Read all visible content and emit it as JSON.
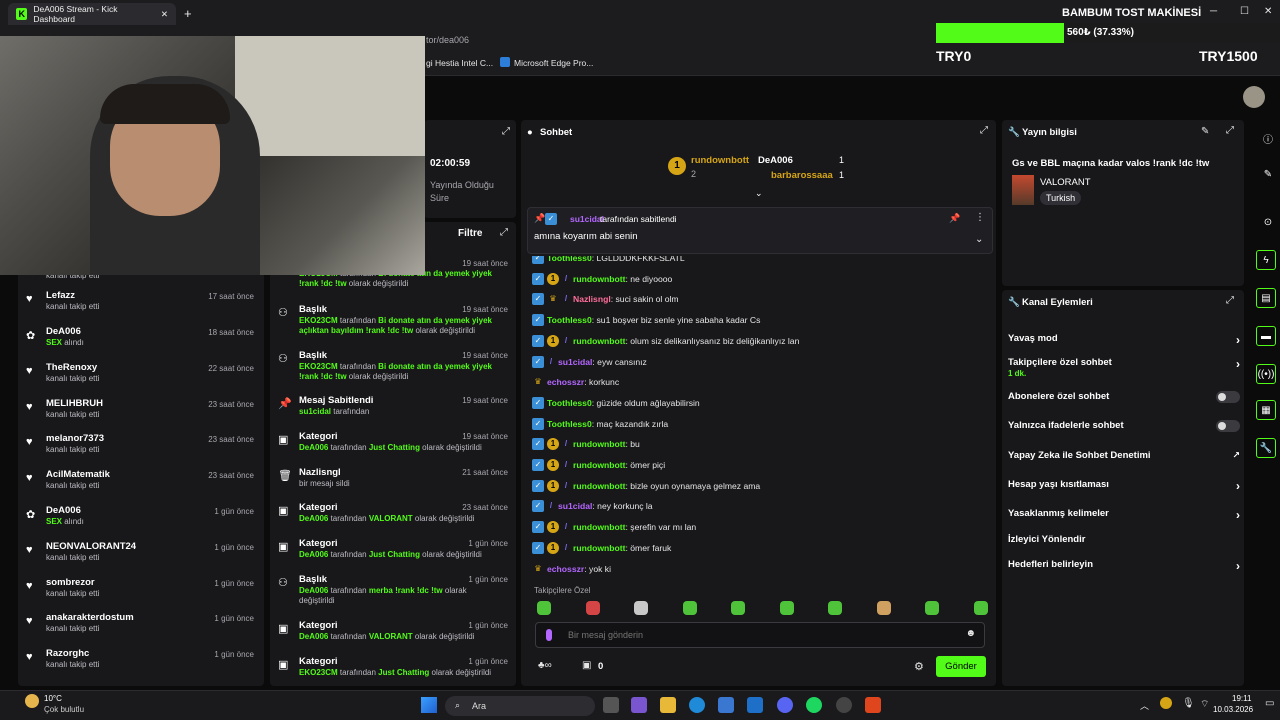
{
  "browser": {
    "tab_title": "DeA006 Stream - Kick Dashboard",
    "address_suffix": "tor/dea006",
    "bookmarks": [
      "gi Hestia Intel C...",
      "Microsoft Edge Pro..."
    ]
  },
  "overlay": {
    "goal_title": "BAMBUM TOST MAKİNESİ",
    "progress_text": "560₺ (37.33%)",
    "progress_fraction": 0.3733,
    "start_label": "TRY0",
    "end_label": "TRY1500"
  },
  "stream_info_panel": {
    "uptime": "02:00:59",
    "uptime_label_1": "Yayında Olduğu",
    "uptime_label_2": "Süre"
  },
  "follows": [
    {
      "name": "",
      "sub": "kanalı takip etti",
      "time": ""
    },
    {
      "name": "Lefazz",
      "sub": "kanalı takip etti",
      "time": "17 saat önce",
      "icon": "heart-icon"
    },
    {
      "name": "DeA006",
      "sub": "SEX",
      "sub2": " alındı",
      "time": "18 saat önce",
      "icon": "gift-icon"
    },
    {
      "name": "TheRenoxy",
      "sub": "kanalı takip etti",
      "time": "22 saat önce",
      "icon": "heart-icon"
    },
    {
      "name": "MELIHBRUH",
      "sub": "kanalı takip etti",
      "time": "23 saat önce",
      "icon": "heart-icon"
    },
    {
      "name": "melanor7373",
      "sub": "kanalı takip etti",
      "time": "23 saat önce",
      "icon": "heart-icon"
    },
    {
      "name": "AcilMatematik",
      "sub": "kanalı takip etti",
      "time": "23 saat önce",
      "icon": "heart-icon"
    },
    {
      "name": "DeA006",
      "sub": "SEX",
      "sub2": " alındı",
      "time": "1 gün önce",
      "icon": "gift-icon"
    },
    {
      "name": "NEONVALORANT24",
      "sub": "kanalı takip etti",
      "time": "1 gün önce",
      "icon": "heart-icon"
    },
    {
      "name": "sombrezor",
      "sub": "kanalı takip etti",
      "time": "1 gün önce",
      "icon": "heart-icon"
    },
    {
      "name": "anakarakterdostum",
      "sub": "kanalı takip etti",
      "time": "1 gün önce",
      "icon": "heart-icon"
    },
    {
      "name": "Razorghc",
      "sub": "kanalı takip etti",
      "time": "1 gün önce",
      "icon": "heart-icon"
    }
  ],
  "activity": {
    "filter_label": "Filtre",
    "items": [
      {
        "name": "",
        "time": "19 saat önce",
        "user": "EKO23CM",
        "t1": " tarafından ",
        "val": "Bi donate atın da yemek yiyek !rank !dc !tw",
        "t2": " olarak değiştirildi"
      },
      {
        "name": "Başlık",
        "time": "19 saat önce",
        "user": "EKO23CM",
        "t1": " tarafından ",
        "val": "Bi donate atın da yemek yiyek açlıktan bayıldım !rank !dc !tw",
        "t2": " olarak değiştirildi"
      },
      {
        "name": "Başlık",
        "time": "19 saat önce",
        "user": "EKO23CM",
        "t1": " tarafından ",
        "val": "Bi donate atın da yemek yiyek !rank !dc !tw",
        "t2": " olarak değiştirildi"
      },
      {
        "name": "Mesaj Sabitlendi",
        "time": "19 saat önce",
        "user": "su1cidal",
        "t1": " tarafından",
        "val": "",
        "t2": ""
      },
      {
        "name": "Kategori",
        "time": "19 saat önce",
        "user": "DeA006",
        "t1": " tarafından ",
        "val": "Just Chatting",
        "t2": " olarak değiştirildi"
      },
      {
        "name": "Nazlisngl",
        "time": "21 saat önce",
        "user": "",
        "t1": "bir mesajı sildi",
        "val": "",
        "t2": ""
      },
      {
        "name": "Kategori",
        "time": "23 saat önce",
        "user": "DeA006",
        "t1": " tarafından ",
        "val": "VALORANT",
        "t2": " olarak değiştirildi"
      },
      {
        "name": "Kategori",
        "time": "1 gün önce",
        "user": "DeA006",
        "t1": " tarafından ",
        "val": "Just Chatting",
        "t2": " olarak değiştirildi"
      },
      {
        "name": "Başlık",
        "time": "1 gün önce",
        "user": "DeA006",
        "t1": " tarafından ",
        "val": "merba !rank !dc !tw",
        "t2": " olarak değiştirildi"
      },
      {
        "name": "Kategori",
        "time": "1 gün önce",
        "user": "DeA006",
        "t1": " tarafından ",
        "val": "VALORANT",
        "t2": " olarak değiştirildi"
      },
      {
        "name": "Kategori",
        "time": "1 gün önce",
        "user": "EKO23CM",
        "t1": " tarafından ",
        "val": "Just Chatting",
        "t2": " olarak değiştirildi"
      }
    ]
  },
  "chat": {
    "title": "Sohbet",
    "leaderboard": [
      {
        "rank": "1",
        "name": "rundownbott",
        "count": "2"
      },
      {
        "name": "DeA006",
        "count": "1"
      },
      {
        "name": "barbarossaaa",
        "count": "1"
      }
    ],
    "pinned": {
      "by": "su1cidal",
      "by_suffix": " tarafından sabitlendi",
      "text": "amına koyarım abi senin"
    },
    "messages": [
      {
        "user": "Toothless0",
        "text": ": LGLDDDKFKKFSLATL",
        "color": "green"
      },
      {
        "user": "rundownbott",
        "text": ": ne diyoooo",
        "color": "green"
      },
      {
        "user": "Nazlisngl",
        "text": ": suci sakin ol olm",
        "color": "pink"
      },
      {
        "user": "Toothless0",
        "text": ": su1 boşver biz senle yine sabaha kadar Cs",
        "color": "green"
      },
      {
        "user": "rundownbott",
        "text": ": olum siz delikanlıysanız biz deliğikanlıyız lan",
        "color": "green"
      },
      {
        "user": "su1cidal",
        "text": ": eyw cansınız",
        "color": "purple"
      },
      {
        "user": "echosszr",
        "text": ": korkunc",
        "color": "purple"
      },
      {
        "user": "Toothless0",
        "text": ": güzide oldum ağlayabilirsin",
        "color": "green"
      },
      {
        "user": "Toothless0",
        "text": ": maç kazandık zırla",
        "color": "green"
      },
      {
        "user": "rundownbott",
        "text": ": bu",
        "color": "green"
      },
      {
        "user": "rundownbott",
        "text": ": ömer piçi",
        "color": "green"
      },
      {
        "user": "rundownbott",
        "text": ": bizle oyun oynamaya gelmez ama",
        "color": "green"
      },
      {
        "user": "su1cidal",
        "text": ": ney korkunç la",
        "color": "purple"
      },
      {
        "user": "rundownbott",
        "text": ": şerefin var mı lan",
        "color": "green"
      },
      {
        "user": "rundownbott",
        "text": ": ömer faruk",
        "color": "green"
      },
      {
        "user": "echosszr",
        "text": ": yok ki",
        "color": "purple"
      }
    ],
    "followers_only_label": "Takipçilere Özel",
    "input_placeholder": "Bir mesaj gönderin",
    "points": "0",
    "send_label": "Gönder"
  },
  "stream_info": {
    "title": "Yayın bilgisi",
    "stream_title": "Gs ve BBL maçına kadar valos !rank !dc !tw",
    "category": "VALORANT",
    "language": "Turkish"
  },
  "channel_actions": {
    "title": "Kanal Eylemleri",
    "items": [
      {
        "label": "Yavaş mod",
        "control": "chevron"
      },
      {
        "label": "Takipçilere özel sohbet",
        "sub": "1 dk.",
        "control": "chevron"
      },
      {
        "label": "Abonelere özel sohbet",
        "control": "toggle"
      },
      {
        "label": "Yalnızca ifadelerle sohbet",
        "control": "toggle"
      },
      {
        "label": "Yapay Zeka ile Sohbet Denetimi",
        "control": "external"
      },
      {
        "label": "Hesap yaşı kısıtlaması",
        "control": "chevron"
      },
      {
        "label": "Yasaklanmış kelimeler",
        "control": "chevron"
      },
      {
        "label": "İzleyici Yönlendir",
        "control": "none"
      },
      {
        "label": "Hedefleri belirleyin",
        "control": "chevron"
      }
    ]
  },
  "taskbar": {
    "weather_temp": "10°C",
    "weather_desc": "Çok bulutlu",
    "search_label": "Ara",
    "time": "19:11",
    "date": "10.03.2026"
  }
}
